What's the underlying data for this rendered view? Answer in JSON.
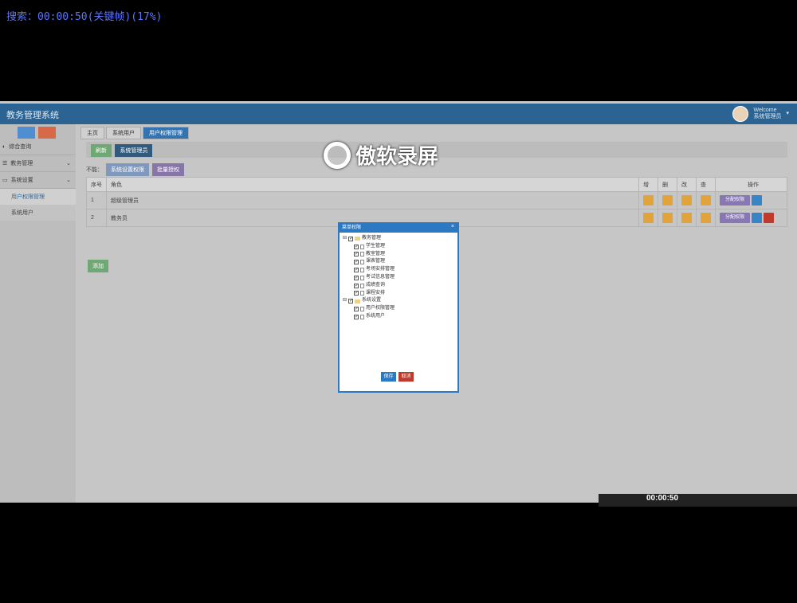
{
  "search_caption": "搜索：00:00:50(关键帧)(17%)",
  "app": {
    "title": "教务管理系统",
    "welcome": "Welcome",
    "user": "系统管理员"
  },
  "sidebar": {
    "items": [
      {
        "label": "综合查询",
        "icon": "dashboard-icon"
      },
      {
        "label": "教务管理",
        "icon": "list-icon"
      },
      {
        "label": "系统设置",
        "icon": "monitor-icon"
      }
    ],
    "subitems": [
      "用户权限管理",
      "系统用户"
    ]
  },
  "tabs": [
    "主页",
    "系统用户",
    "用户权限管理"
  ],
  "toolbar": {
    "refresh": "刷新",
    "permission": "系统管理员"
  },
  "filter": {
    "label": "不能：",
    "btn1": "系统设置权限",
    "btn2": "批量授权"
  },
  "table": {
    "headers": [
      "序号",
      "角色",
      "增",
      "删",
      "改",
      "查",
      "操作"
    ],
    "rows": [
      {
        "id": "1",
        "role": "超级管理员",
        "op": "分配权限"
      },
      {
        "id": "2",
        "role": "教务员",
        "op": "分配权限"
      }
    ]
  },
  "add_button": "添加",
  "dialog": {
    "title": "菜单权限",
    "groups": [
      {
        "name": "教务管理",
        "children": [
          "学生管理",
          "教室管理",
          "课表管理",
          "考场安排管理",
          "考试信息管理",
          "成绩查询",
          "课程安排"
        ]
      },
      {
        "name": "系统设置",
        "children": [
          "用户权限管理",
          "系统用户"
        ]
      }
    ],
    "save": "保存",
    "cancel": "取消"
  },
  "watermark": "傲软录屏",
  "recorder_time": "00:00:50",
  "colors": {
    "topbar": "#2b6493",
    "accent": "#2b79c2",
    "cancel": "#c0392b"
  }
}
